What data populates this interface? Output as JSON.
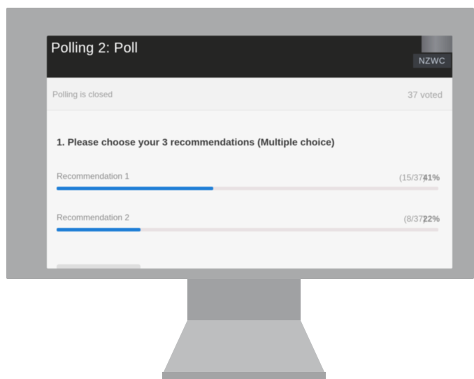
{
  "window": {
    "title": "Polling 2: Poll",
    "logo_text": "NZWC"
  },
  "status": {
    "closed_text": "Polling is closed",
    "voted_text": "37 voted"
  },
  "question": {
    "text": "1. Please choose your 3 recommendations (Multiple choice)"
  },
  "options": [
    {
      "label": "Recommendation 1",
      "count": "(15/37)",
      "percent": "41%",
      "fraction": 0.41
    },
    {
      "label": "Recommendation 2",
      "count": "(8/37)",
      "percent": "22%",
      "fraction": 0.22
    }
  ],
  "colors": {
    "titlebar": "#252524",
    "progress_fill": "#1e7ed6",
    "progress_track": "#e8e1e3",
    "monitor_frame": "#a9aaab"
  }
}
